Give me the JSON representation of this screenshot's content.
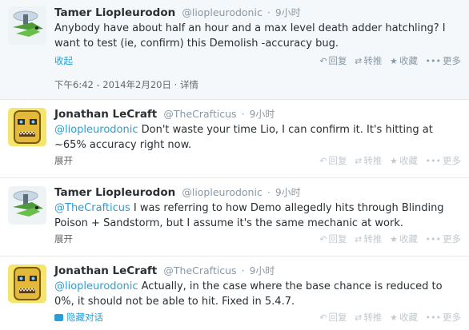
{
  "tweets": [
    {
      "name": "Tamer Liopleurodon",
      "handle": "@liopleurodonic",
      "dot": "·",
      "time": "9小时",
      "text": "Anybody have about half an hour and a max level death adder hatchling? I want to test (ie, confirm) this Demolish -accuracy bug.",
      "toggle": "收起",
      "timestamp": "下午6:42 - 2014年2月20日",
      "detail_sep": "·",
      "detail": "详情",
      "avatar": "hatchling-avatar"
    },
    {
      "name": "Jonathan LeCraft",
      "handle": "@TheCrafticus",
      "dot": "·",
      "time": "9小时",
      "mention": "@liopleurodonic",
      "text": " Don't waste your time Lio, I can confirm it.  It's hitting at ~65% accuracy right now.",
      "toggle": "展开",
      "avatar": "tiki-mask-avatar"
    },
    {
      "name": "Tamer Liopleurodon",
      "handle": "@liopleurodonic",
      "dot": "·",
      "time": "9小时",
      "mention": "@TheCrafticus",
      "text": " I was referring to how Demo allegedly hits through Blinding Poison + Sandstorm, but I assume it's the same mechanic at work.",
      "toggle": "展开",
      "avatar": "hatchling-avatar"
    },
    {
      "name": "Jonathan LeCraft",
      "handle": "@TheCrafticus",
      "dot": "·",
      "time": "9小时",
      "mention": "@liopleurodonic",
      "text": " Actually, in the case where the base chance is reduced to 0%, it should not be able to hit. Fixed in 5.4.7.",
      "toggle": "隐藏对话",
      "avatar": "tiki-mask-avatar"
    }
  ],
  "actions": {
    "reply_label": "回复",
    "retweet_label": "转推",
    "favorite_label": "收藏",
    "more_label": "更多"
  },
  "colors": {
    "link": "#2a9fd6",
    "muted": "#8899a6",
    "expanded_bg": "#f5f8fa"
  }
}
